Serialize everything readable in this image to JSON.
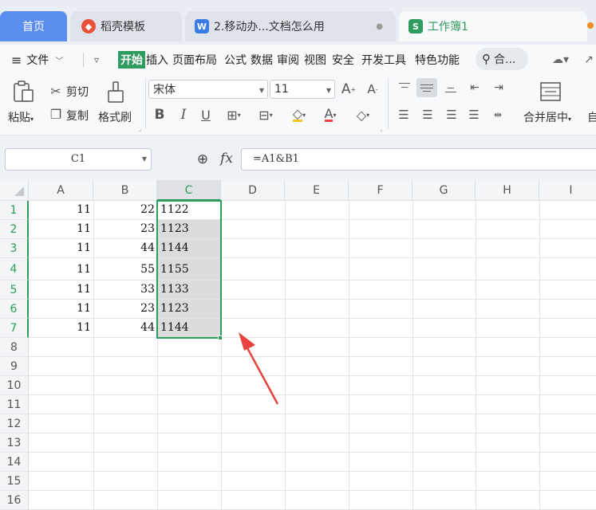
{
  "tabs": {
    "home": "首页",
    "template": "稻壳模板",
    "doc": "2.移动办...文档怎么用",
    "doc_badge": "W",
    "workbook": "工作簿1",
    "workbook_badge": "S"
  },
  "menu": {
    "file": "文件",
    "items": [
      "开始",
      "插入",
      "页面布局",
      "公式",
      "数据",
      "审阅",
      "视图",
      "安全",
      "开发工具",
      "特色功能"
    ],
    "search": "合..."
  },
  "ribbon": {
    "paste": "粘贴",
    "cut": "剪切",
    "copy": "复制",
    "format_painter": "格式刷",
    "font_name": "宋体",
    "font_size": "11",
    "bold": "B",
    "italic": "I",
    "underline": "U",
    "font_color": "A",
    "merge_center": "合并居中",
    "merge_center_suffix": "自"
  },
  "formula_bar": {
    "name_box": "C1",
    "fx": "fx",
    "formula": "=A1&B1"
  },
  "grid": {
    "columns": [
      "A",
      "B",
      "C",
      "D",
      "E",
      "F",
      "G",
      "H",
      "I"
    ],
    "selected_column": "C",
    "rows": [
      "1",
      "2",
      "3",
      "4",
      "5",
      "6",
      "7",
      "8",
      "9",
      "10",
      "11",
      "12",
      "13",
      "14",
      "15",
      "16"
    ],
    "data": [
      {
        "a": "11",
        "b": "22",
        "c": "1122"
      },
      {
        "a": "11",
        "b": "23",
        "c": "1123"
      },
      {
        "a": "11",
        "b": "44",
        "c": "1144"
      },
      {
        "a": "11",
        "b": "55",
        "c": "1155"
      },
      {
        "a": "11",
        "b": "33",
        "c": "1133"
      },
      {
        "a": "11",
        "b": "23",
        "c": "1123"
      },
      {
        "a": "11",
        "b": "44",
        "c": "1144"
      }
    ]
  },
  "colors": {
    "accent": "#2e9c5e",
    "home_tab": "#5b8def",
    "arrow": "#e8423f"
  }
}
